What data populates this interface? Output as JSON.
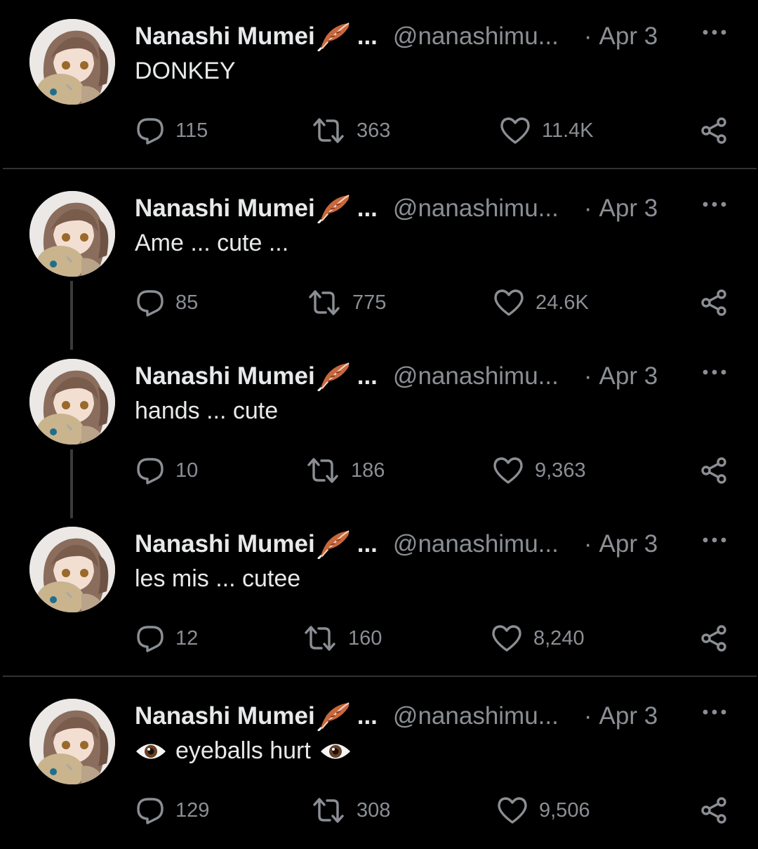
{
  "colors": {
    "background": "#000000",
    "text": "#e7e9ea",
    "muted": "#8b8f94",
    "divider": "#2f3336"
  },
  "tweets": [
    {
      "name": "Nanashi Mumei",
      "name_suffix": "...",
      "handle": "@nanashimu...",
      "sep": "·",
      "date": "Apr 3",
      "text": "DONKEY",
      "replies": "115",
      "retweets": "363",
      "likes": "11.4K"
    },
    {
      "name": "Nanashi Mumei",
      "name_suffix": "...",
      "handle": "@nanashimu...",
      "sep": "·",
      "date": "Apr 3",
      "text": "Ame ... cute ...",
      "replies": "85",
      "retweets": "775",
      "likes": "24.6K"
    },
    {
      "name": "Nanashi Mumei",
      "name_suffix": "...",
      "handle": "@nanashimu...",
      "sep": "·",
      "date": "Apr 3",
      "text": "hands ... cute",
      "replies": "10",
      "retweets": "186",
      "likes": "9,363"
    },
    {
      "name": "Nanashi Mumei",
      "name_suffix": "...",
      "handle": "@nanashimu...",
      "sep": "·",
      "date": "Apr 3",
      "text": "les mis ... cutee",
      "replies": "12",
      "retweets": "160",
      "likes": "8,240"
    },
    {
      "name": "Nanashi Mumei",
      "name_suffix": "...",
      "handle": "@nanashimu...",
      "sep": "·",
      "date": "Apr 3",
      "text": "eyeballs hurt",
      "text_prefix_emoji": "eye-emoji",
      "text_suffix_emoji": "eye-emoji",
      "replies": "129",
      "retweets": "308",
      "likes": "9,506"
    }
  ],
  "icons": {
    "verified_emoji": "feather-icon",
    "more": "more-icon",
    "reply": "reply-icon",
    "retweet": "retweet-icon",
    "like": "heart-icon",
    "share": "share-icon"
  }
}
